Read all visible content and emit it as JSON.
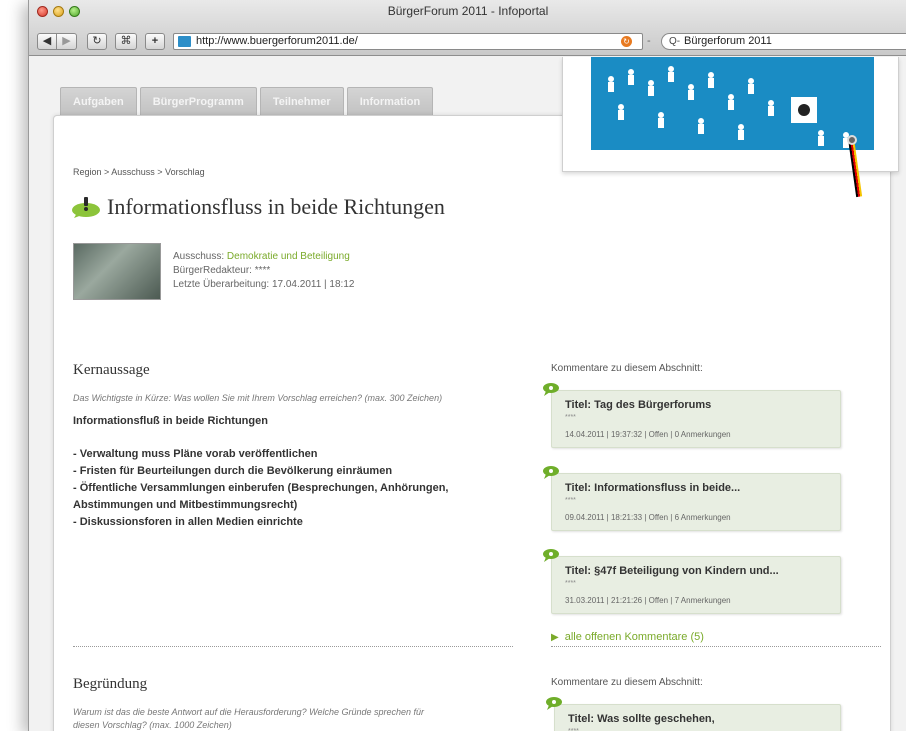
{
  "window": {
    "title": "BürgerForum 2011 - Infoportal"
  },
  "toolbar": {
    "back": "◀",
    "forward": "▶",
    "reload": "↻",
    "rss": "⌘",
    "add": "+",
    "url": "http://www.buergerforum2011.de/",
    "search_value": "Bürgerforum 2011",
    "search_glyph": "Q-"
  },
  "tabs": [
    "Aufgaben",
    "BürgerProgramm",
    "Teilnehmer",
    "Information"
  ],
  "breadcrumb": "Region > Ausschuss > Vorschlag",
  "proposal": {
    "title": "Informationsfluss in beide Richtungen",
    "committee_label": "Ausschuss:",
    "committee_value": "Demokratie und Beteiligung",
    "editor_label": "BürgerRedakteur:",
    "editor_value": "****",
    "updated_label": "Letzte Überarbeitung:",
    "updated_value": "17.04.2011 | 18:12"
  },
  "kernaussage": {
    "heading": "Kernaussage",
    "hint": "Das Wichtigste in Kürze: Was wollen Sie mit Ihrem Vorschlag erreichen? (max. 300 Zeichen)",
    "lead": "Informationsfluß in beide Richtungen",
    "lines": [
      "- Verwaltung muss Pläne vorab veröffentlichen",
      "- Fristen für Beurteilungen durch die Bevölkerung einräumen",
      "- Öffentliche Versammlungen einberufen (Besprechungen, Anhörungen,",
      "Abstimmungen und Mitbestimmungsrecht)",
      "- Diskussionsforen in allen Medien einrichte"
    ]
  },
  "comments_1": {
    "heading": "Kommentare zu diesem Abschnitt:",
    "items": [
      {
        "title": "Titel: Tag des Bürgerforums",
        "author": "****",
        "meta": "14.04.2011 | 19:37:32 | Offen | 0 Anmerkungen"
      },
      {
        "title": "Titel: Informationsfluss in beide...",
        "author": "****",
        "meta": "09.04.2011 | 18:21:33 | Offen | 6 Anmerkungen"
      },
      {
        "title": "Titel: §47f Beteiligung von Kindern und...",
        "author": "****",
        "meta": "31.03.2011 | 21:21:26 | Offen | 7 Anmerkungen"
      }
    ],
    "all_link": "alle offenen Kommentare (5)"
  },
  "begruendung": {
    "heading": "Begründung",
    "hint_line1": "Warum ist das die beste Antwort auf die Herausforderung? Welche Gründe sprechen für",
    "hint_line2": "diesen Vorschlag? (max. 1000 Zeichen)"
  },
  "comments_2": {
    "heading": "Kommentare zu diesem Abschnitt:",
    "items": [
      {
        "title": "Titel: Was sollte geschehen,",
        "author": "****"
      }
    ]
  },
  "colors": {
    "accent_green": "#7aaa2a",
    "banner_blue": "#1a8cc4",
    "comment_bg": "#e8eee2"
  },
  "icons": [
    "back-arrow-icon",
    "forward-arrow-icon",
    "reload-icon",
    "rss-icon",
    "add-bookmark-icon",
    "favicon-icon",
    "search-icon",
    "speech-bubble-icon",
    "comment-icon",
    "triangle-arrow-icon"
  ]
}
